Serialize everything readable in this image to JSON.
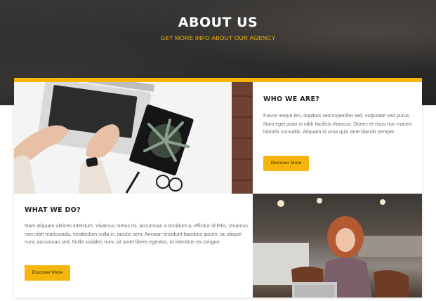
{
  "hero": {
    "title": "ABOUT US",
    "subtitle": "GET MORE INFO ABOUT OUR AGENCY"
  },
  "who_we_are": {
    "title": "WHO WE ARE?",
    "text": "Fusce neque leo, dapibus sed imperdiet sed, vulputate sed purus. Nam eget justo in nibh facilisis rhoncus. Donec et risus non mauris lobortis convallis. Aliquam id urna quis ante blandit semper.",
    "button_label": "Discover More"
  },
  "what_we_do": {
    "title": "WHAT WE DO?",
    "text": "Nam aliquam ultrices interdum. Vivamus metus mi, accumsan a tincidunt a, efficitur id felis. Vivamus non nibh malesuada, vestibulum nulla in, iaculis sem. Aenean tincidunt faucibus ipsum, ac aliquet nunc accumsan sed. Nulla sodales nunc sit amet libero egestas, ut interdum ex congue.",
    "button_label": "Discover More"
  },
  "colors": {
    "accent": "#f5b50a",
    "hero_background": "#2b2a29",
    "heading": "#222222",
    "body_text": "#6b6b6b"
  },
  "images": {
    "top_left": "laptop-typing-photo",
    "bottom_right": "woman-cafe-laptop-photo"
  }
}
